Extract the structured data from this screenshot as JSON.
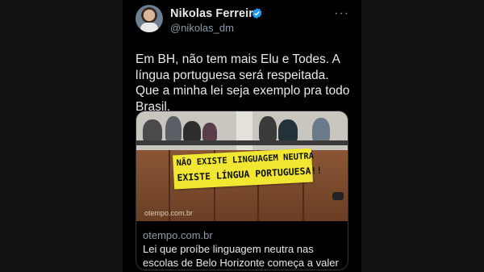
{
  "colors": {
    "background": "#000000",
    "side_bars": "#121212",
    "text_primary": "#e7e9ea",
    "text_secondary": "#8b98a5",
    "verified_badge": "#1d9bf0",
    "banner": "#f1e733"
  },
  "author": {
    "name": "Nikolas Ferreira",
    "handle": "@nikolas_dm",
    "verified_icon": "verified-badge-icon",
    "more_label": "···"
  },
  "tweet": {
    "text": "Em BH, não tem mais Elu e Todes. A língua portuguesa será respeitada. Que a minha lei seja exemplo pra todo Brasil."
  },
  "link_card": {
    "banner_line1": "NÃO EXISTE LINGUAGEM NEUTRA",
    "banner_line2": "EXISTE LÍNGUA PORTUGUESA!!",
    "watermark": "otempo.com.br",
    "domain": "otempo.com.br",
    "headline": "Lei que proíbe linguagem neutra nas escolas de Belo Horizonte começa a valer"
  }
}
